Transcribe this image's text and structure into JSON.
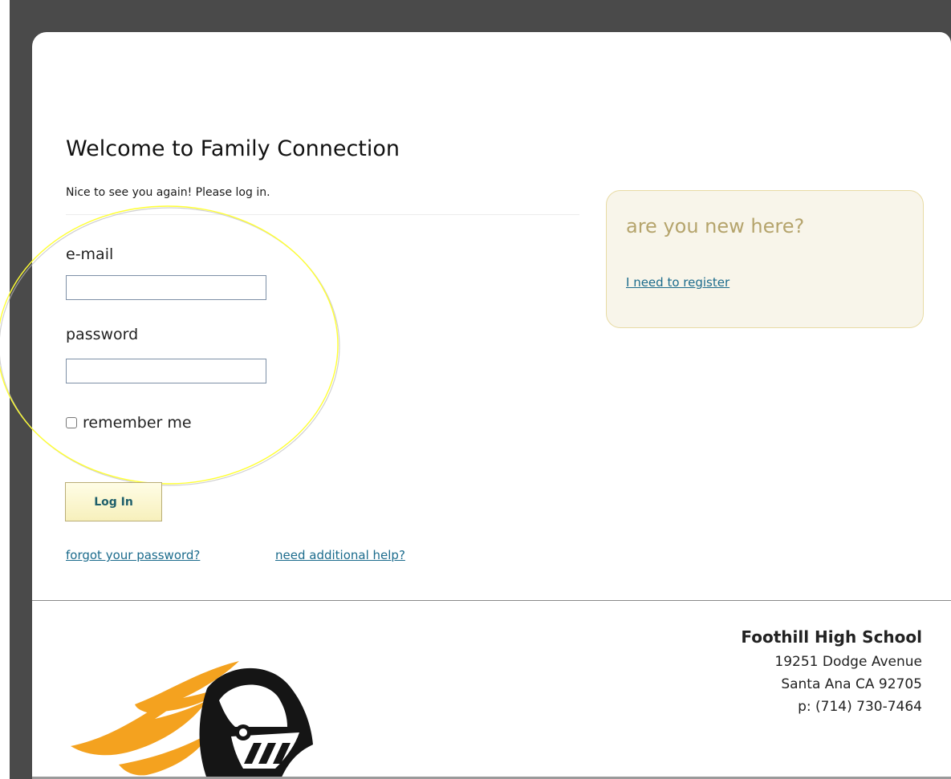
{
  "login": {
    "title": "Welcome to Family Connection",
    "subtitle": "Nice to see you again! Please log in.",
    "email_label": "e-mail",
    "email_value": "",
    "password_label": "password",
    "password_value": "",
    "remember_label": "remember me",
    "remember_checked": false,
    "login_button": "Log In",
    "forgot_link": "forgot your password?",
    "help_link": "need additional help?"
  },
  "new_user": {
    "title": "are you new here?",
    "register_link": "I need to register"
  },
  "footer": {
    "school_name": "Foothill High School",
    "street": "19251 Dodge Avenue",
    "city": "Santa Ana CA 92705",
    "phone": "p: (714) 730-7464",
    "logo_icon": "knight-helmet-icon"
  },
  "annotation": {
    "highlight_color": "#ffff33"
  },
  "colors": {
    "link": "#1b6b8c",
    "button_text": "#1f5f6b",
    "new_box_title": "#b5a46c",
    "mascot_orange": "#f4a21f",
    "mascot_black": "#151515"
  }
}
